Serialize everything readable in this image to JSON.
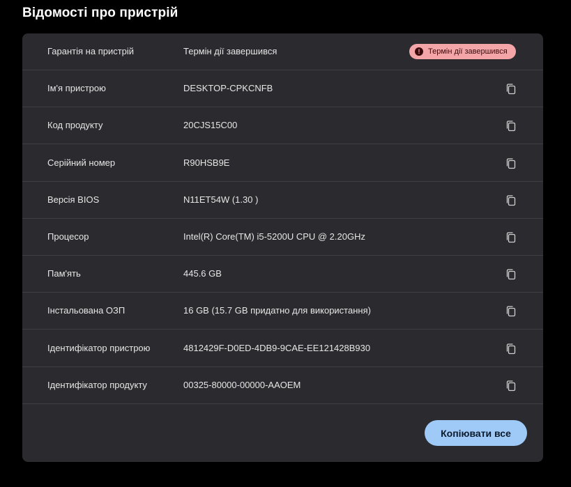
{
  "page": {
    "title": "Відомості про пристрій"
  },
  "warranty": {
    "label": "Гарантія на пристрій",
    "value": "Термін дії завершився",
    "badge_text": "Термін дії завершився",
    "badge_icon": "!",
    "badge_color": "#f4a5a8"
  },
  "rows": [
    {
      "label": "Ім'я пристрою",
      "value": "DESKTOP-CPKCNFB"
    },
    {
      "label": "Код продукту",
      "value": "20CJS15C00"
    },
    {
      "label": "Серійний номер",
      "value": "R90HSB9E"
    },
    {
      "label": "Версія BIOS",
      "value": "N11ET54W (1.30 )"
    },
    {
      "label": "Процесор",
      "value": "Intel(R) Core(TM) i5-5200U CPU @ 2.20GHz"
    },
    {
      "label": "Пам'ять",
      "value": "445.6 GB"
    },
    {
      "label": "Інстальована ОЗП",
      "value": "16 GB (15.7 GB придатно для використання)"
    },
    {
      "label": "Ідентифікатор пристрою",
      "value": "4812429F-D0ED-4DB9-9CAE-EE121428B930"
    },
    {
      "label": "Ідентифікатор продукту",
      "value": "00325-80000-00000-AAOEM"
    }
  ],
  "actions": {
    "copy_all_label": "Копіювати все"
  },
  "colors": {
    "background": "#000000",
    "card": "#2b2b2f",
    "accent": "#9fcaf8",
    "icon": "copy-icon"
  }
}
